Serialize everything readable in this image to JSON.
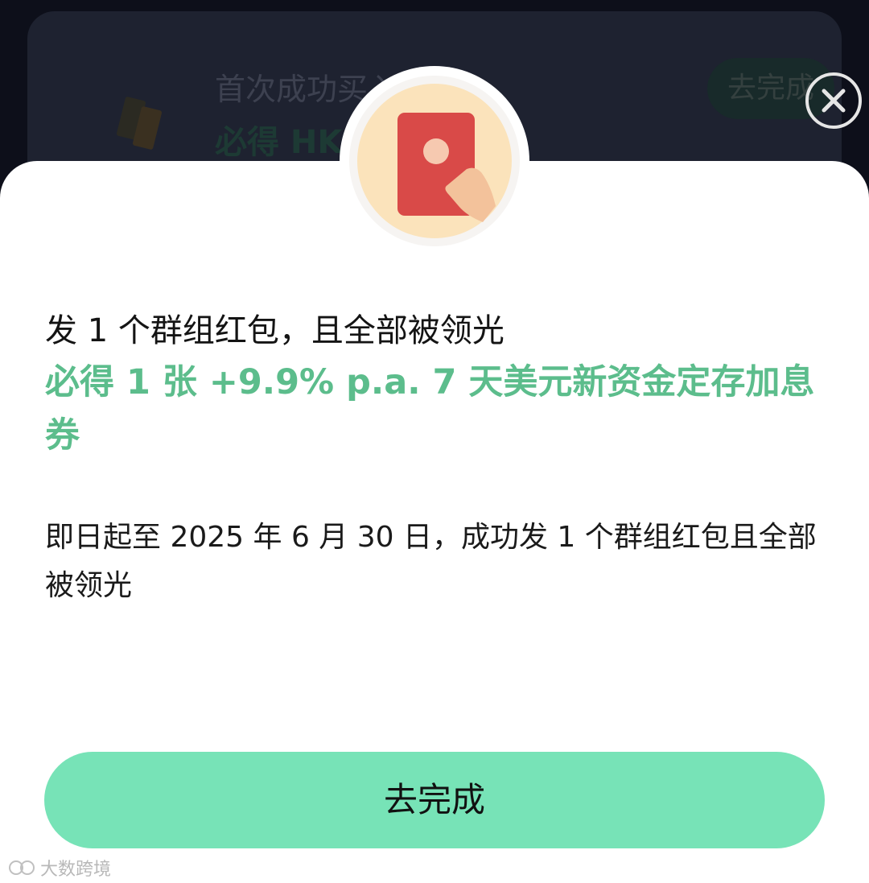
{
  "background_task": {
    "title": "首次成功买入美股",
    "reward": "必得 HKD",
    "button_label": "去完成"
  },
  "close": {
    "icon": "close-icon"
  },
  "task": {
    "icon": "red-envelope-icon",
    "headline": "发 1 个群组红包，且全部被领光",
    "reward": "必得 1 张 +9.9% p.a. 7 天美元新资金定存加息券",
    "description": "即日起至 2025 年 6 月 30 日，成功发 1 个群组红包且全部被领光",
    "button_label": "去完成"
  },
  "watermark": {
    "text": "大数跨境"
  },
  "colors": {
    "accent_green": "#5cbd8c",
    "button_green": "#77e3b7",
    "overlay": "#0d0f1a"
  }
}
